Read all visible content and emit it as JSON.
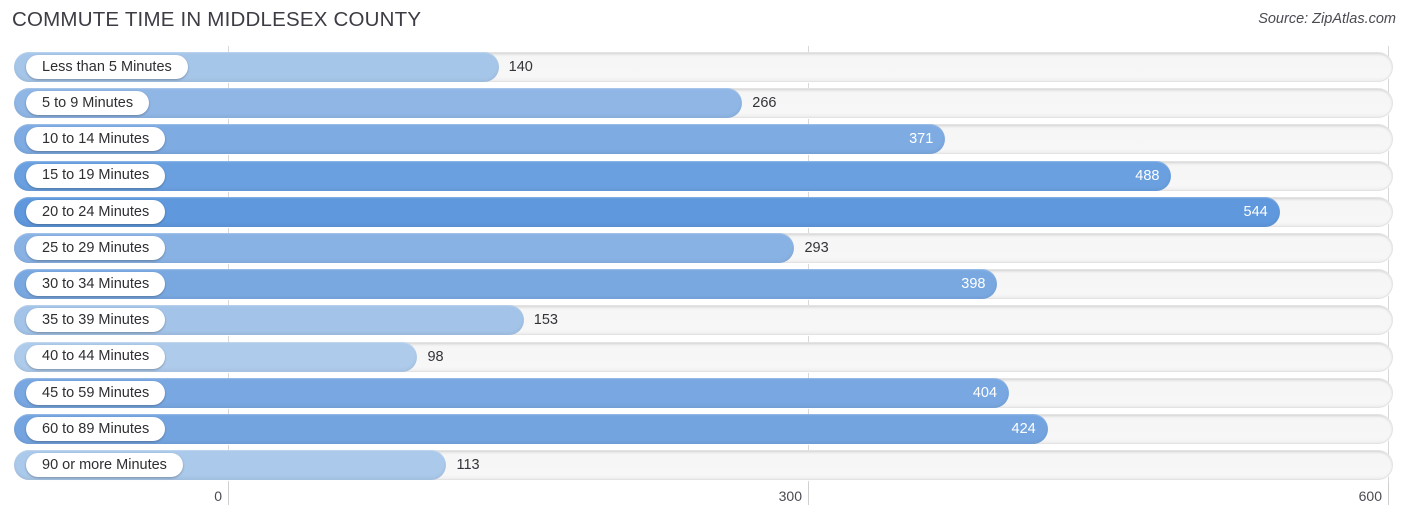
{
  "header": {
    "title": "COMMUTE TIME IN MIDDLESEX COUNTY",
    "source": "Source: ZipAtlas.com"
  },
  "axis": {
    "ticks": [
      "0",
      "300",
      "600"
    ],
    "min": 0,
    "max": 600
  },
  "colors": {
    "lightest_bar": "#a6c6e9",
    "darkest_bar": "#5f98dd",
    "track": "#f6f6f6",
    "gridline": "#d8d8d8",
    "value_outside": "#33333a",
    "value_inside": "#ffffff",
    "title": "#3c3c44"
  },
  "chart_data": {
    "type": "bar",
    "orientation": "horizontal",
    "title": "COMMUTE TIME IN MIDDLESEX COUNTY",
    "xlabel": "",
    "ylabel": "",
    "xlim": [
      0,
      600
    ],
    "grid": true,
    "legend": "none",
    "categories": [
      "Less than 5 Minutes",
      "5 to 9 Minutes",
      "10 to 14 Minutes",
      "15 to 19 Minutes",
      "20 to 24 Minutes",
      "25 to 29 Minutes",
      "30 to 34 Minutes",
      "35 to 39 Minutes",
      "40 to 44 Minutes",
      "45 to 59 Minutes",
      "60 to 89 Minutes",
      "90 or more Minutes"
    ],
    "values": [
      140,
      266,
      371,
      488,
      544,
      293,
      398,
      153,
      98,
      404,
      424,
      113
    ],
    "value_labels": [
      "140",
      "266",
      "371",
      "488",
      "544",
      "293",
      "398",
      "153",
      "98",
      "404",
      "424",
      "113"
    ],
    "bar_colors": [
      "#a6c6e9",
      "#8fb6e5",
      "#7dabe2",
      "#6aa0e0",
      "#5f98dd",
      "#89b2e4",
      "#79a8e1",
      "#a3c4e8",
      "#aecbeb",
      "#78a7e1",
      "#74a4e0",
      "#abc9ea"
    ],
    "label_position": [
      "outside",
      "outside",
      "inside",
      "inside",
      "inside",
      "outside",
      "inside",
      "outside",
      "outside",
      "inside",
      "inside",
      "outside"
    ]
  }
}
